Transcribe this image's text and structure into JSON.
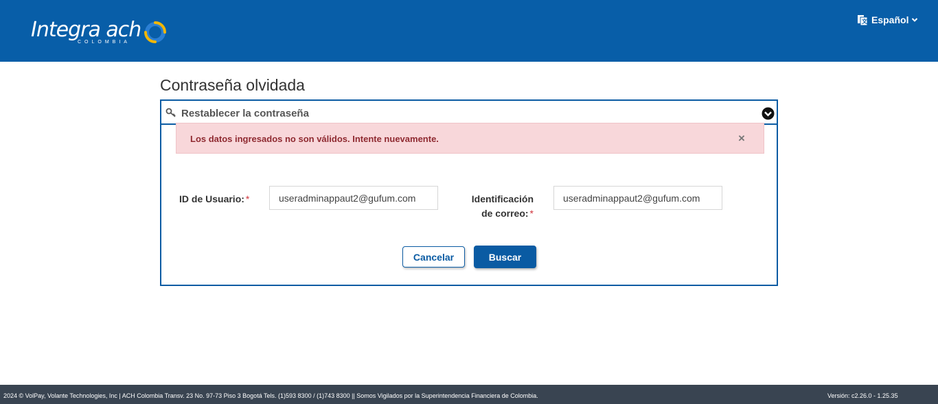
{
  "header": {
    "logo": {
      "brand": "Integra ach",
      "sub": "COLOMBIA"
    },
    "language": {
      "label": "Español",
      "icon": "translate-icon"
    },
    "colors": {
      "header_bg": "#085ea8",
      "logo_ring_blue": "#2b7fd4",
      "logo_ring_yellow": "#f2b705"
    }
  },
  "page": {
    "title": "Contraseña olvidada"
  },
  "panel": {
    "title": "Restablecer la contraseña",
    "icons": {
      "title": "key-icon",
      "collapse": "chevron-down-circle-icon"
    },
    "alert": {
      "message": "Los datos ingresados no son válidos. Intente nuevamente.",
      "close": "×"
    },
    "fields": {
      "user_id": {
        "label": "ID de Usuario:",
        "required": "*",
        "value": "useradminappaut2@gufum.com"
      },
      "email": {
        "label_line1": "Identificación",
        "label_line2": "de correo:",
        "required": "*",
        "value": "useradminappaut2@gufum.com"
      }
    },
    "buttons": {
      "cancel": "Cancelar",
      "search": "Buscar"
    }
  },
  "footer": {
    "left": "2024 © VolPay, Volante Technologies, Inc | ACH Colombia Transv. 23 No. 97-73 Piso 3 Bogotá Tels. (1)593 8300 / (1)743 8300 || Somos Vigilados por la Superintendencia Financiera de Colombia.",
    "right": "Versión: c2.26.0 - 1.25.35"
  }
}
